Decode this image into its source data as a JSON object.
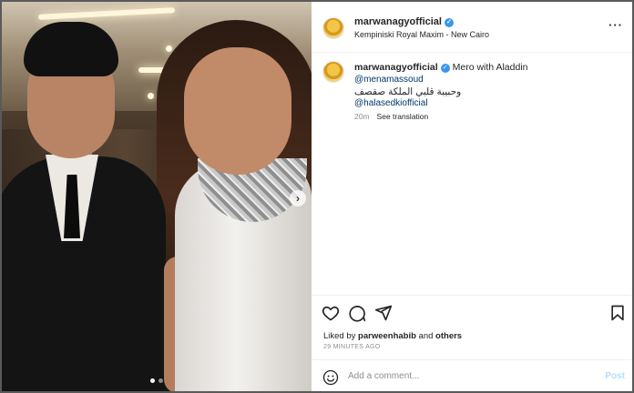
{
  "post": {
    "username": "marwanagyofficial",
    "location": "Kempiniski Royal Maxim - New Cairo"
  },
  "caption": {
    "username": "marwanagyofficial",
    "text": "Mero with Aladdin",
    "mention1": "@menamassoud",
    "arabic_line": "وحبيبة قلبي الملكة صقصف",
    "mention2": "@halasedkiofficial",
    "time": "20m",
    "see_translation": "See translation"
  },
  "likes": {
    "prefix": "Liked by",
    "user": "parweenhabib",
    "joiner": "and",
    "others": "others"
  },
  "timestamp": "29 MINUTES AGO",
  "comment": {
    "placeholder": "Add a comment...",
    "post_label": "Post"
  },
  "carousel": {
    "slide_count": 2,
    "active_index": 0
  },
  "colors": {
    "verified": "#3897f0",
    "mention": "#00376b",
    "post_button_disabled": "#b2dffc"
  },
  "icons": {
    "like": "heart-icon",
    "comment": "comment-icon",
    "share": "paper-plane-icon",
    "save": "bookmark-icon",
    "more": "more-options-icon",
    "emoji": "emoji-icon",
    "next": "chevron-right-icon"
  }
}
